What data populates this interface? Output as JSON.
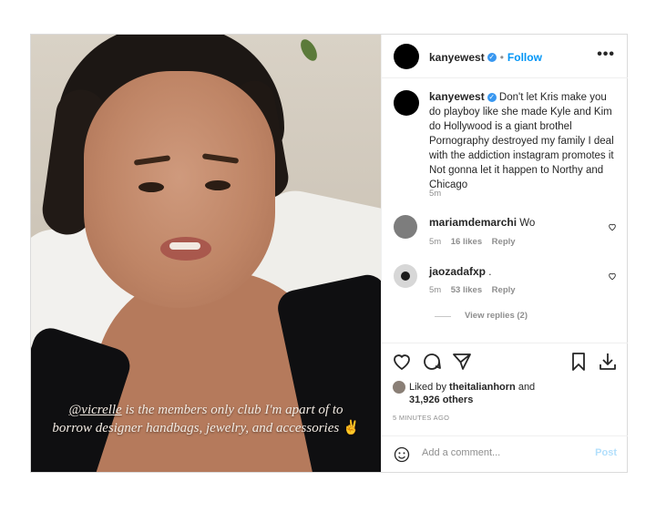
{
  "post": {
    "author": "kanyewest",
    "follow_label": "Follow",
    "separator": "•",
    "more_label": "•••"
  },
  "photo": {
    "caption_handle": "@vicrelle",
    "caption_text": " is the members only club I'm apart of to borrow designer handbags, jewelry, and accessories ",
    "caption_glyph": "✌"
  },
  "caption_comment": {
    "author": "kanyewest",
    "text": "Don't let Kris make you do playboy like she made Kyle and Kim do Hollywood is a giant brothel Pornography destroyed my family I deal with the addiction instagram promotes it Not gonna let it happen to Northy and Chicago",
    "time": "5m"
  },
  "comments": [
    {
      "author": "mariamdemarchi",
      "text": "Wo",
      "time": "5m",
      "likes": "16 likes",
      "reply": "Reply"
    },
    {
      "author": "jaozadafxp",
      "text": ".",
      "time": "5m",
      "likes": "53 likes",
      "reply": "Reply"
    }
  ],
  "view_replies": "View replies (2)",
  "likes": {
    "prefix": "Liked by ",
    "user": "theitalianhorn",
    "middle": " and",
    "count": "31,926 others"
  },
  "timestamp": "5 MINUTES AGO",
  "comment_box": {
    "placeholder": "Add a comment...",
    "post_label": "Post"
  },
  "colors": {
    "accent": "#0095f6",
    "verified": "#3897f0",
    "muted": "#8e8e8e"
  },
  "icons": [
    "heart-icon",
    "comment-icon",
    "share-icon",
    "bookmark-icon",
    "download-icon",
    "emoji-icon"
  ]
}
